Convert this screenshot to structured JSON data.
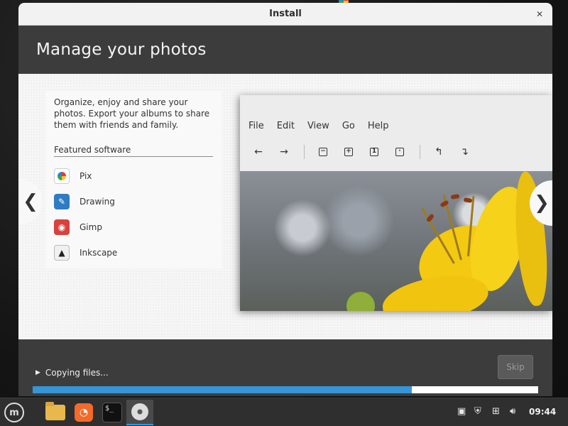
{
  "window": {
    "title": "Install",
    "close_label": "✕"
  },
  "slide": {
    "title": "Manage your photos",
    "description": "Organize, enjoy and share your photos. Export your albums to share them with friends and family.",
    "featured_heading": "Featured software",
    "apps": [
      {
        "label": "Pix",
        "icon": "pix-icon"
      },
      {
        "label": "Drawing",
        "icon": "drawing-icon"
      },
      {
        "label": "Gimp",
        "icon": "gimp-icon"
      },
      {
        "label": "Inkscape",
        "icon": "inkscape-icon"
      }
    ],
    "preview_menu": [
      "File",
      "Edit",
      "View",
      "Go",
      "Help"
    ],
    "prev_label": "❮",
    "next_label": "❯"
  },
  "progress": {
    "status": "Copying files...",
    "skip_label": "Skip",
    "percent": 75,
    "fill_color": "#3595d6"
  },
  "taskbar": {
    "clock": "09:44"
  },
  "colors": {
    "header_bg": "#3c3c3c",
    "accent": "#3595d6"
  }
}
